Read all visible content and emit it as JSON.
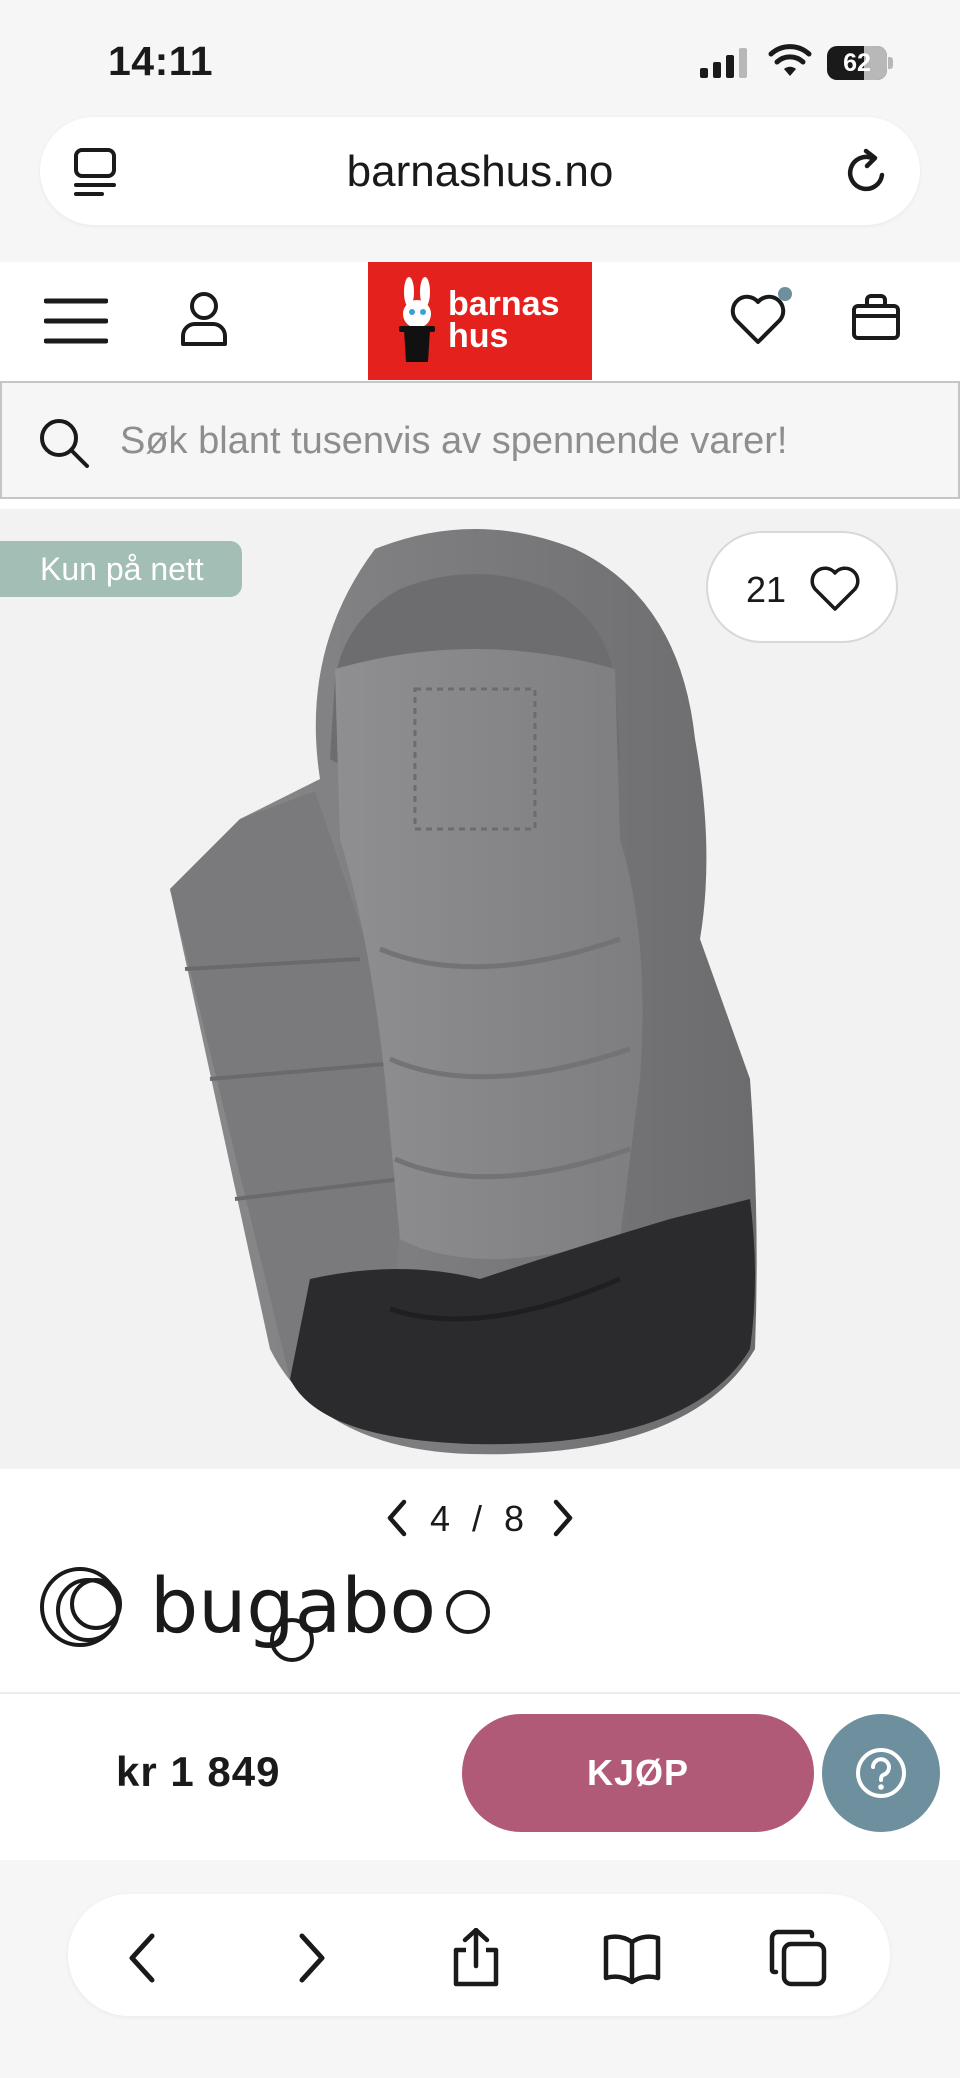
{
  "status_bar": {
    "time": "14:11",
    "battery": "62",
    "battery_level": 0.62
  },
  "browser": {
    "url": "barnashus.no"
  },
  "header": {
    "logo_line1": "barnas",
    "logo_line2": "hus",
    "brand_color": "#e5211d"
  },
  "search": {
    "placeholder": "Søk blant tusenvis av spennende varer!"
  },
  "product": {
    "badge": "Kun på nett",
    "like_count": "21",
    "pager": "4 / 8",
    "brand": "bugabo",
    "price": "kr 1 849",
    "buy_label": "KJØP",
    "buy_color": "#b15a77",
    "help_color": "#6e8f9d"
  },
  "icons": {
    "tabs": "tabs-icon",
    "reload": "reload-icon",
    "menu": "menu-icon",
    "user": "user-icon",
    "wishlist": "heart-icon",
    "cart": "bag-icon",
    "search": "search-icon",
    "help": "question-icon",
    "back": "chevron-left-icon",
    "forward": "chevron-right-icon",
    "share": "share-icon",
    "bookmarks": "book-icon",
    "tab_switcher": "tabs-overview-icon"
  }
}
